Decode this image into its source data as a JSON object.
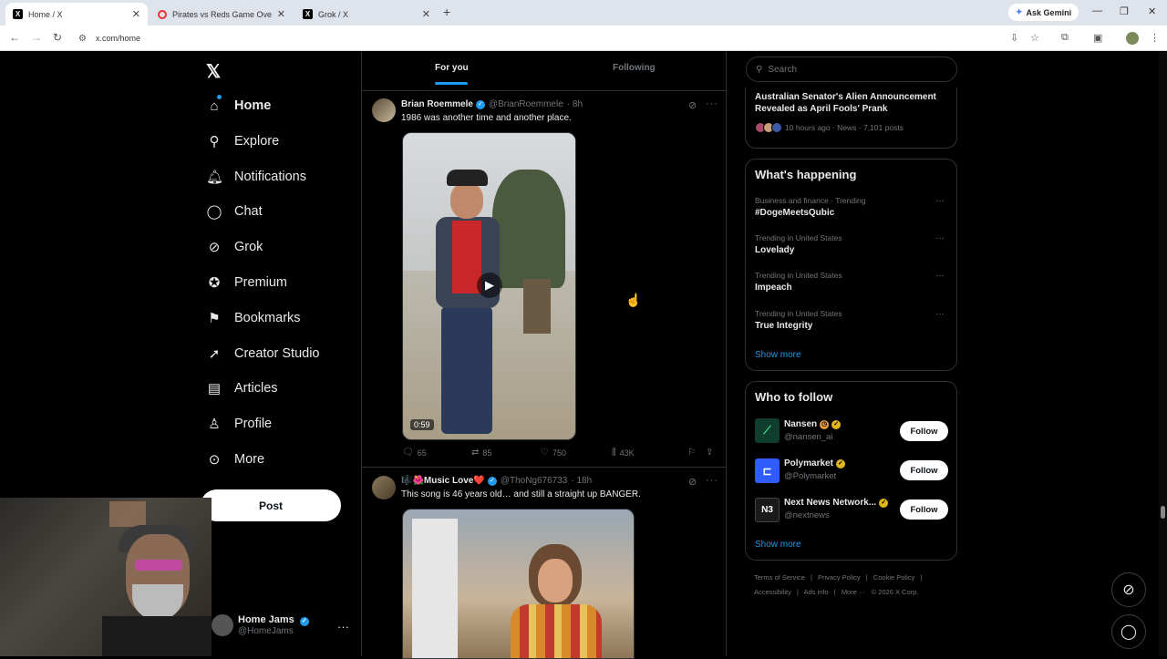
{
  "browser": {
    "tabs": [
      {
        "label": "Home / X",
        "active": true
      },
      {
        "label": "Pirates vs Reds Game Overview",
        "active": false
      },
      {
        "label": "Grok / X",
        "active": false
      }
    ],
    "new_tab": "+",
    "ask_gemini": "Ask Gemini",
    "url": "x.com/home",
    "minimize": "—",
    "restore": "❐",
    "close": "✕"
  },
  "sidebar": {
    "logo": "𝕏",
    "items": [
      {
        "label": "Home",
        "icon": "home-icon",
        "glyph": "⌂"
      },
      {
        "label": "Explore",
        "icon": "search-icon",
        "glyph": "⚲"
      },
      {
        "label": "Notifications",
        "icon": "bell-icon",
        "glyph": "🔔︎"
      },
      {
        "label": "Chat",
        "icon": "chat-icon",
        "glyph": "◯"
      },
      {
        "label": "Grok",
        "icon": "grok-icon",
        "glyph": "⊘"
      },
      {
        "label": "Premium",
        "icon": "verified-icon",
        "glyph": "✪"
      },
      {
        "label": "Bookmarks",
        "icon": "bookmark-icon",
        "glyph": "⚑"
      },
      {
        "label": "Creator Studio",
        "icon": "rocket-icon",
        "glyph": "➚"
      },
      {
        "label": "Articles",
        "icon": "article-icon",
        "glyph": "▤"
      },
      {
        "label": "Profile",
        "icon": "person-icon",
        "glyph": "♙"
      },
      {
        "label": "More",
        "icon": "more-circle-icon",
        "glyph": "⊙"
      }
    ],
    "post_label": "Post",
    "account": {
      "name": "Home Jams",
      "handle": "@HomeJams",
      "more": "···"
    }
  },
  "feed": {
    "tabs": [
      {
        "label": "For you",
        "active": true
      },
      {
        "label": "Following",
        "active": false
      }
    ],
    "tweets": [
      {
        "name": "Brian Roemmele",
        "handle": "@BrianRoemmele",
        "time": "· 8h",
        "text": "1986 was another time and another place.",
        "duration": "0:59",
        "replies": "65",
        "reposts": "85",
        "likes": "750",
        "views": "43K"
      },
      {
        "name": "🎼🌺Music Love❤️",
        "handle": "@ThoNg676733",
        "time": "· 18h",
        "text": "This song is 46 years old… and still a straight up BANGER."
      }
    ]
  },
  "right": {
    "search_placeholder": "Search",
    "news": {
      "title": "Australian Senator's Alien Announcement Revealed as April Fools' Prank",
      "meta": "10 hours ago · News · 7,101 posts"
    },
    "happening": {
      "heading": "What's happening",
      "trends": [
        {
          "category": "Business and finance · Trending",
          "name": "#DogeMeetsQubic"
        },
        {
          "category": "Trending in United States",
          "name": "Lovelady"
        },
        {
          "category": "Trending in United States",
          "name": "Impeach"
        },
        {
          "category": "Trending in United States",
          "name": "True Integrity"
        }
      ],
      "show_more": "Show more"
    },
    "who_to_follow": {
      "heading": "Who to follow",
      "accounts": [
        {
          "name": "Nansen",
          "handle": "@nansen_ai",
          "color": "#0f3d2e"
        },
        {
          "name": "Polymarket",
          "handle": "@Polymarket",
          "color": "#2e5cff"
        },
        {
          "name": "Next News Network...",
          "handle": "@nextnews",
          "color": "#1a1a1a"
        }
      ],
      "follow_label": "Follow",
      "show_more": "Show more"
    },
    "footer": {
      "line1": [
        "Terms of Service",
        "|",
        "Privacy Policy",
        "|",
        "Cookie Policy",
        "|"
      ],
      "line2": [
        "Accessibility",
        "|",
        "Ads info",
        "|",
        "More ···",
        "© 2026 X Corp."
      ]
    }
  },
  "colors": {
    "accent": "#1d9bf0",
    "gold": "#e2b719",
    "background": "#000000"
  }
}
